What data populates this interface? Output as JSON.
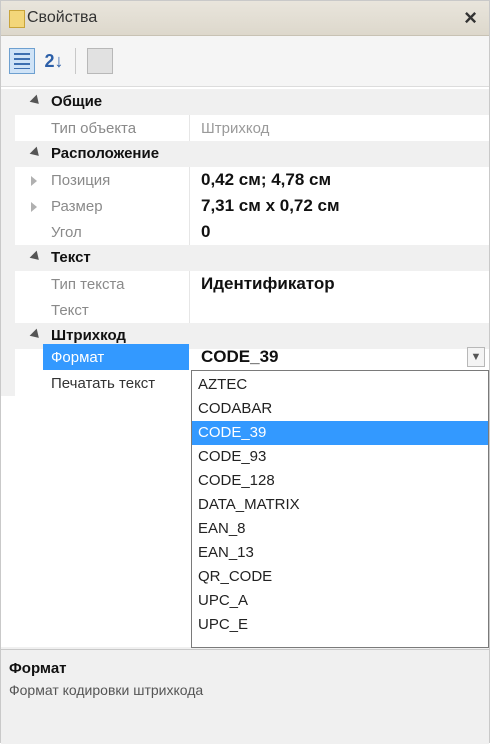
{
  "window": {
    "title": "Свойства",
    "close_glyph": "×"
  },
  "toolbar": {
    "categorized_icon": "categorized-icon",
    "alphabetical_icon": "alphabetical-sort-icon",
    "alphabetical_glyph": "2↓",
    "pages_icon": "property-pages-icon"
  },
  "grid": {
    "general": {
      "label": "Общие",
      "object_type_label": "Тип объекта",
      "object_type_value": "Штрихкод"
    },
    "layout": {
      "label": "Расположение",
      "position_label": "Позиция",
      "position_value": "0,42 см; 4,78 см",
      "size_label": "Размер",
      "size_value": "7,31 см x 0,72 см",
      "angle_label": "Угол",
      "angle_value": "0"
    },
    "text": {
      "label": "Текст",
      "text_type_label": "Тип текста",
      "text_type_value": "Идентификатор",
      "text_label": "Текст"
    },
    "barcode": {
      "label": "Штрихкод",
      "format_label": "Формат",
      "format_value": "CODE_39",
      "print_text_label": "Печатать текст"
    }
  },
  "dropdown": {
    "options": [
      "AZTEC",
      "CODABAR",
      "CODE_39",
      "CODE_93",
      "CODE_128",
      "DATA_MATRIX",
      "EAN_8",
      "EAN_13",
      "QR_CODE",
      "UPC_A",
      "UPC_E"
    ],
    "selected": "CODE_39"
  },
  "description": {
    "title": "Формат",
    "text": "Формат кодировки штрихкода"
  },
  "colors": {
    "selection": "#3399ff",
    "panel": "#f0f0f0"
  }
}
